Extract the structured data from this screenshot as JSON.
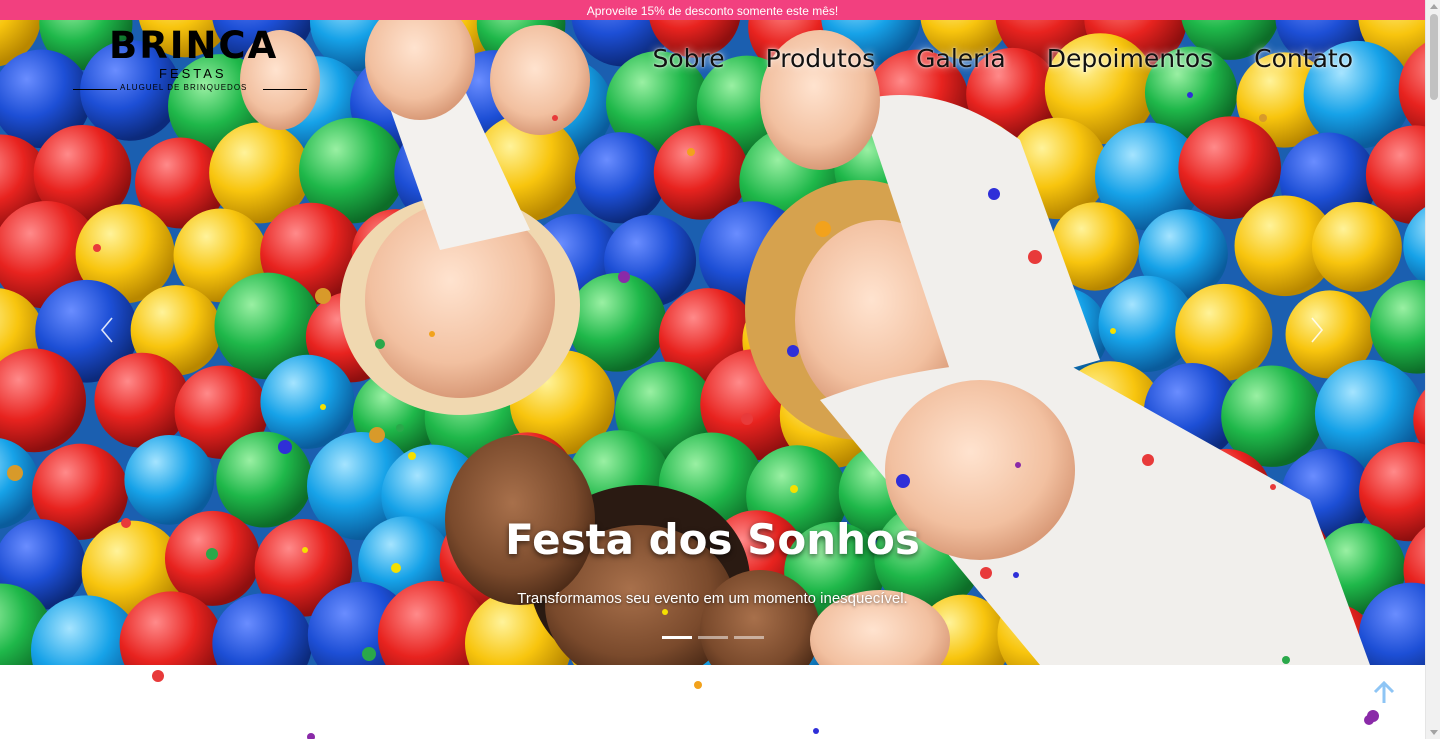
{
  "promo": {
    "text": "Aproveite 15% de desconto somente este mês!"
  },
  "logo": {
    "brand": "BRINCA",
    "sub": "FESTAS",
    "tagline": "ALUGUEL DE BRINQUEDOS"
  },
  "nav": {
    "items": [
      "Sobre",
      "Produtos",
      "Galeria",
      "Depoimentos",
      "Contato"
    ]
  },
  "hero": {
    "title": "Festa dos Sonhos",
    "subtitle": "Transformamos seu evento em um momento inesquecível.",
    "slides": 3,
    "active_slide": 0
  },
  "icons": {
    "prev": "chevron-left-icon",
    "next": "chevron-right-icon",
    "to_top": "arrow-up-icon"
  },
  "colors": {
    "promo_bg": "#f2407f",
    "to_top": "#8ec5f5"
  }
}
